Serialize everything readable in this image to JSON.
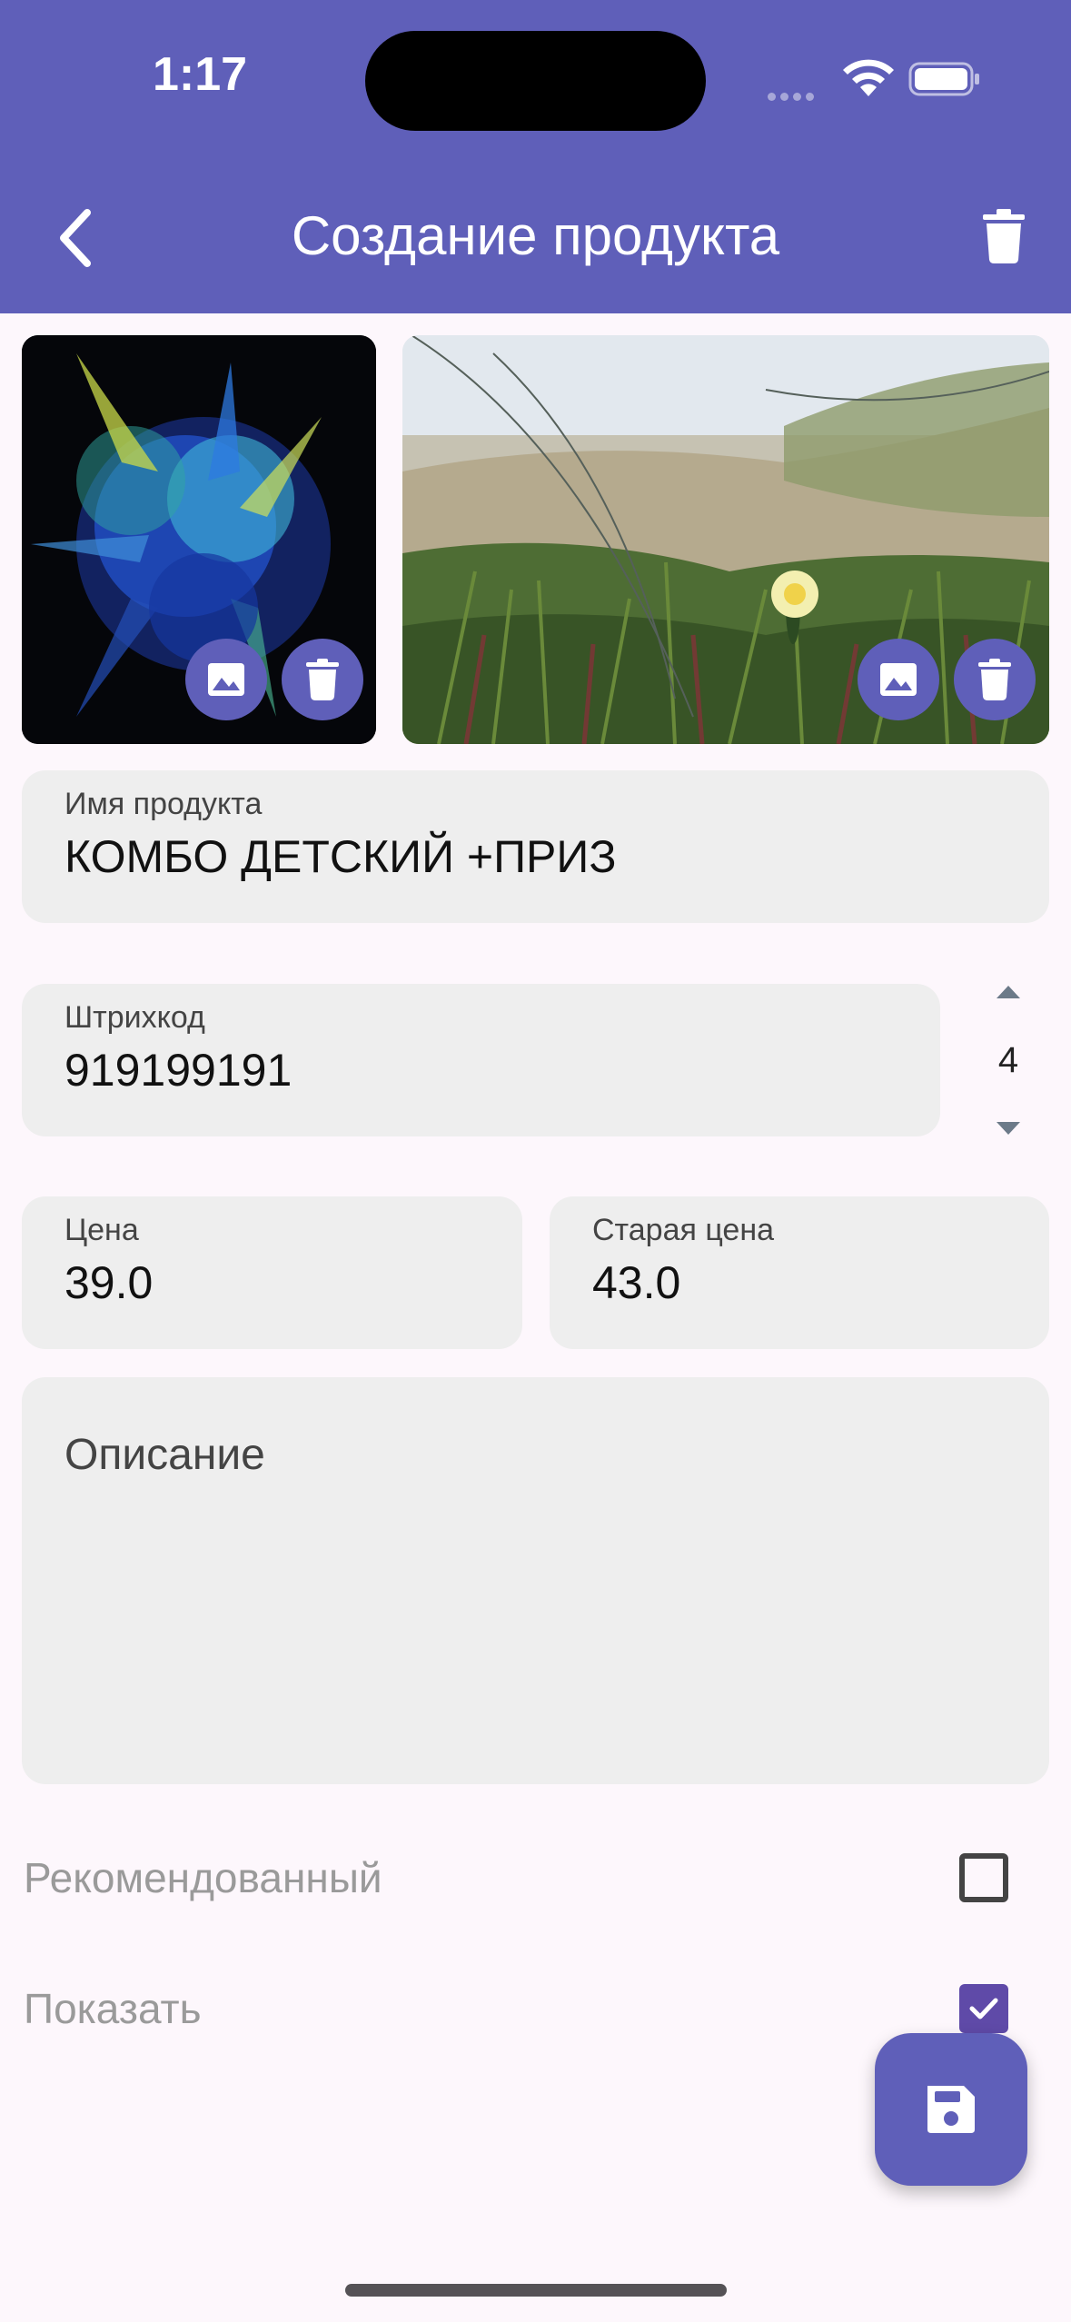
{
  "status": {
    "time": "1:17"
  },
  "app_bar": {
    "title": "Создание продукта",
    "back_icon": "arrow-back-icon",
    "delete_icon": "trash-icon"
  },
  "photos": [
    {
      "description_icon": "image-icon",
      "delete_icon": "trash-icon"
    },
    {
      "description_icon": "image-icon",
      "delete_icon": "trash-icon"
    }
  ],
  "form": {
    "name": {
      "label": "Имя продукта",
      "value": "КОМБО ДЕТСКИЙ +ПРИЗ"
    },
    "barcode": {
      "label": "Штрихкод",
      "value": "919199191"
    },
    "stepper": {
      "value": "4"
    },
    "price": {
      "label": "Цена",
      "value": "39.0"
    },
    "old_price": {
      "label": "Старая цена",
      "value": "43.0"
    },
    "description": {
      "placeholder": "Описание"
    },
    "recommended": {
      "label": "Рекомендованный",
      "checked": false
    },
    "show": {
      "label": "Показать",
      "checked": true
    }
  },
  "fab": {
    "icon": "save-icon"
  },
  "colors": {
    "primary": "#5F5FB9",
    "background": "#FDF7FC",
    "field": "#EEEEEE",
    "checkbox": "#5F4AA8"
  }
}
